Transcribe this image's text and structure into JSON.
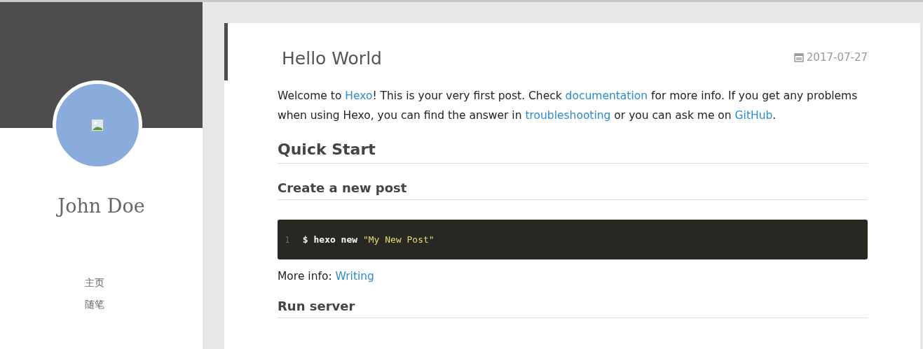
{
  "sidebar": {
    "author": "John Doe",
    "nav": [
      {
        "label": "主页"
      },
      {
        "label": "随笔"
      }
    ]
  },
  "post": {
    "title": "Hello World",
    "date": "2017-07-27",
    "blocks": [
      {
        "kind": "paragraph",
        "parts": [
          {
            "text": "Welcome to "
          },
          {
            "text": "Hexo",
            "link": true
          },
          {
            "text": "! This is your very first post. Check "
          },
          {
            "text": "documentation",
            "link": true
          },
          {
            "text": " for more info. If you get any problems when using Hexo, you can find the answer in "
          },
          {
            "text": "troubleshooting",
            "link": true
          },
          {
            "text": " or you can ask me on "
          },
          {
            "text": "GitHub",
            "link": true
          },
          {
            "text": "."
          }
        ]
      },
      {
        "kind": "h2",
        "text": "Quick Start"
      },
      {
        "kind": "h3",
        "text": "Create a new post"
      },
      {
        "kind": "code",
        "line_number": "1",
        "parts": [
          {
            "text": "$ hexo new "
          },
          {
            "text": "\"My New Post\"",
            "string": true
          }
        ]
      },
      {
        "kind": "paragraph",
        "parts": [
          {
            "text": "More info: "
          },
          {
            "text": "Writing",
            "link": true
          }
        ]
      },
      {
        "kind": "h3",
        "text": "Run server"
      }
    ]
  }
}
